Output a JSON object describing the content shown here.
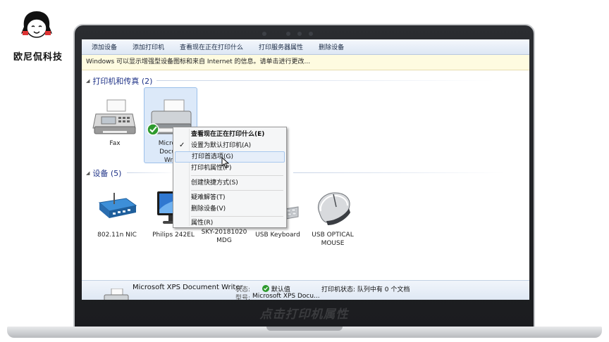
{
  "brand": {
    "name": "欧尼侃科技"
  },
  "toolbar": {
    "items": [
      "添加设备",
      "添加打印机",
      "查看现在正在打印什么",
      "打印服务器属性",
      "删除设备"
    ]
  },
  "infobar": {
    "text": "Windows 可以显示增强型设备图标和来自 Internet 的信息。请单击进行更改..."
  },
  "groups": {
    "printers": {
      "header": "打印机和传真 (2)"
    },
    "devices": {
      "header": "设备 (5)"
    }
  },
  "printers": [
    {
      "label": "Fax",
      "icon": "fax-icon"
    },
    {
      "label_lines": [
        "Microso",
        "Docum",
        "Writ"
      ],
      "icon": "printer-icon",
      "default": true
    }
  ],
  "devices": [
    {
      "label_lines": [
        "802.11n NIC"
      ],
      "icon": "network-adapter-icon"
    },
    {
      "label_lines": [
        "Philips 242EL"
      ],
      "icon": "monitor-icon"
    },
    {
      "label_lines": [
        "SKY-20181020",
        "MDG"
      ],
      "icon": "computer-icon"
    },
    {
      "label_lines": [
        "USB Keyboard"
      ],
      "icon": "keyboard-icon"
    },
    {
      "label_lines": [
        "USB OPTICAL",
        "MOUSE"
      ],
      "icon": "mouse-icon"
    }
  ],
  "context_menu": {
    "items": [
      {
        "label": "查看现在正在打印什么(E)",
        "bold": true
      },
      {
        "label": "设置为默认打印机(A)",
        "checked": true
      },
      {
        "label": "打印首选项(G)",
        "hover": true
      },
      {
        "label": "打印机属性(P)"
      },
      {
        "label": "创建快捷方式(S)"
      },
      {
        "label": "疑难解答(T)"
      },
      {
        "label": "删除设备(V)"
      },
      {
        "label": "属性(R)"
      }
    ]
  },
  "details": {
    "name": "Microsoft XPS Document Writer",
    "status_label": "状态:",
    "status_value": "默认值",
    "model_label": "型号:",
    "model_value": "Microsoft XPS Docu...",
    "printer_status": "打印机状态: 队列中有 0 个文档"
  },
  "caption": "点击打印机属性",
  "colors": {
    "accent": "#1e3287",
    "selection": "#dce9f9",
    "default_check": "#2e9a2e"
  }
}
